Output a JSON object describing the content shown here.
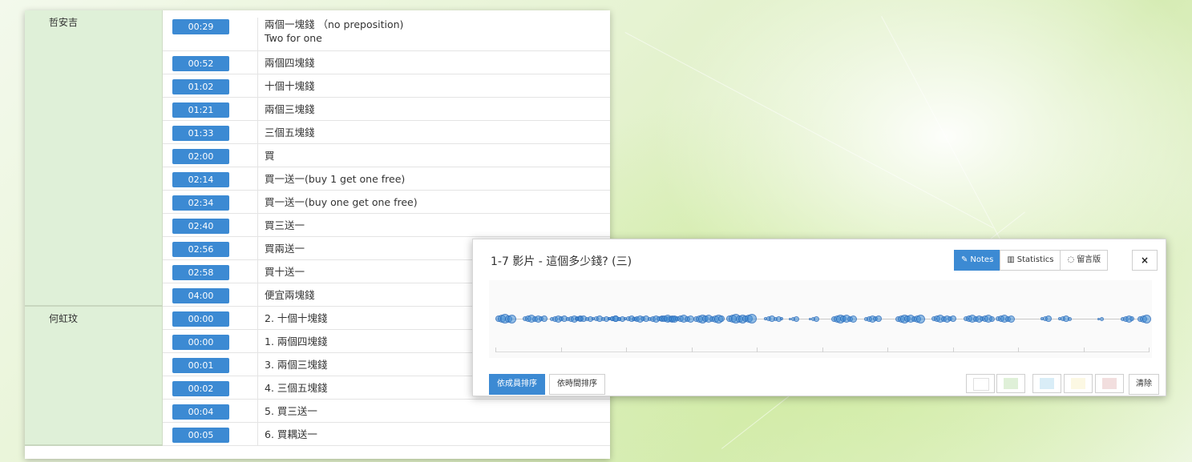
{
  "notes_table": {
    "groups": [
      {
        "student": "哲安吉",
        "rows": [
          {
            "time": "00:29",
            "note": "兩個一塊錢 （no preposition)\nTwo for one"
          },
          {
            "time": "00:52",
            "note": "兩個四塊錢"
          },
          {
            "time": "01:02",
            "note": "十個十塊錢"
          },
          {
            "time": "01:21",
            "note": "兩個三塊錢"
          },
          {
            "time": "01:33",
            "note": "三個五塊錢"
          },
          {
            "time": "02:00",
            "note": "買"
          },
          {
            "time": "02:14",
            "note": "買一送一(buy 1 get one free)"
          },
          {
            "time": "02:34",
            "note": "買一送一(buy one get one free)"
          },
          {
            "time": "02:40",
            "note": "買三送一"
          },
          {
            "time": "02:56",
            "note": "買兩送一"
          },
          {
            "time": "02:58",
            "note": "買十送一"
          },
          {
            "time": "04:00",
            "note": "便宜兩塊錢"
          }
        ]
      },
      {
        "student": "何虹玟",
        "rows": [
          {
            "time": "00:00",
            "note": "2. 十個十塊錢"
          },
          {
            "time": "00:00",
            "note": "1. 兩個四塊錢"
          },
          {
            "time": "00:01",
            "note": "3. 兩個三塊錢"
          },
          {
            "time": "00:02",
            "note": "4. 三個五塊錢"
          },
          {
            "time": "00:04",
            "note": "5. 買三送一"
          },
          {
            "time": "00:05",
            "note": "6. 買耦送一"
          }
        ]
      }
    ]
  },
  "popup": {
    "title": "1-7 影片 - 這個多少錢? (三)",
    "tabs": [
      {
        "label": "Notes",
        "icon": "edit-icon",
        "active": true
      },
      {
        "label": "Statistics",
        "icon": "bar-chart-icon",
        "active": false
      },
      {
        "label": "留言版",
        "icon": "comment-icon",
        "active": false
      }
    ],
    "close_label": "×",
    "sort_buttons": [
      {
        "label": "依成員排序",
        "active": true
      },
      {
        "label": "依時間排序",
        "active": false
      }
    ],
    "color_filters": [
      {
        "name": "white",
        "color": "#ffffff"
      },
      {
        "name": "green",
        "color": "#dff0d8"
      },
      {
        "name": "blue",
        "color": "#d9edf7"
      },
      {
        "name": "yellow",
        "color": "#fcf8e3"
      },
      {
        "name": "red",
        "color": "#f2dede"
      }
    ],
    "clear_label": "清除",
    "accent_color": "#3c8ad3"
  }
}
